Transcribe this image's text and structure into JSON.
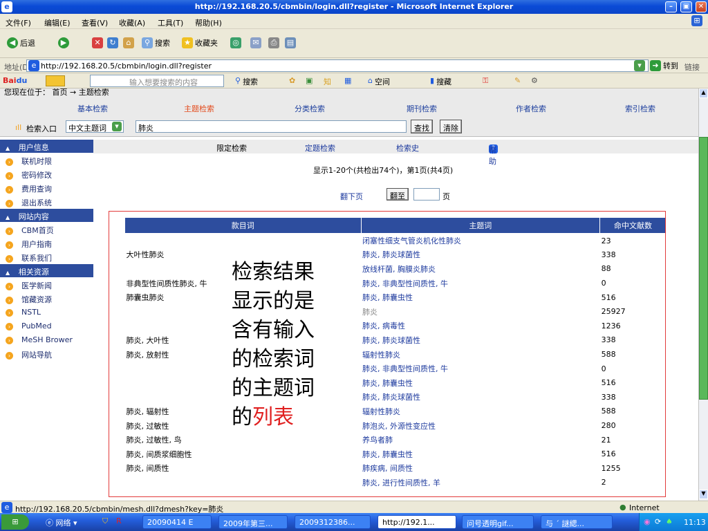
{
  "window": {
    "title": "http://192.168.20.5/cbmbin/login.dll?register - Microsoft Internet Explorer"
  },
  "menu": [
    "文件(F)",
    "编辑(E)",
    "查看(V)",
    "收藏(A)",
    "工具(T)",
    "帮助(H)"
  ],
  "toolbar": {
    "back": "后退",
    "search": "搜索",
    "favorites": "收藏夹"
  },
  "address": {
    "label": "地址(D)",
    "url": "http://192.168.20.5/cbmbin/login.dll?register",
    "go": "转到",
    "links": "链接"
  },
  "baidu": {
    "placeholder": "输入想要搜索的内容",
    "search": "搜索",
    "space": "空间",
    "bookmark": "搜藏"
  },
  "breadcrumb": "您现在位于： 首页 → 主题检索",
  "tabs": [
    "基本检索",
    "主题检索",
    "分类检索",
    "期刊检索",
    "作者检索",
    "索引检索"
  ],
  "search": {
    "entry_label": "检索入口",
    "field": "中文主题词",
    "query": "肺炎",
    "find": "查找",
    "clear": "清除"
  },
  "subnav": [
    "限定检索",
    "定题检索",
    "检索史",
    "帮助"
  ],
  "sidebar": {
    "sections": [
      {
        "title": "用户信息",
        "items": [
          "联机时限",
          "密码修改",
          "费用查询",
          "退出系统"
        ]
      },
      {
        "title": "网站内容",
        "items": [
          "CBM首页",
          "用户指南",
          "联系我们"
        ]
      },
      {
        "title": "相关资源",
        "items": [
          "医学新闻",
          "馆藏资源",
          "NSTL",
          "PubMed",
          "MeSH Brower",
          "网站导航"
        ]
      }
    ]
  },
  "results": {
    "summary": "显示1-20个(共检出74个)，第1页(共4页)",
    "next_page": "翻下页",
    "jump": "翻至",
    "page_unit": "页",
    "headers": [
      "款目词",
      "主题词",
      "命中文献数"
    ],
    "rows": [
      [
        "",
        "闭塞性细支气管炎机化性肺炎",
        "23"
      ],
      [
        "大叶性肺炎",
        "肺炎, 肺炎球菌性",
        "338"
      ],
      [
        "",
        "放线杆菌, 胸膜炎肺炎",
        "88"
      ],
      [
        "非典型性间质性肺炎, 牛",
        "肺炎, 非典型性间质性, 牛",
        "0"
      ],
      [
        "肺囊虫肺炎",
        "肺炎, 肺囊虫性",
        "516"
      ],
      [
        "",
        "肺炎",
        "25927"
      ],
      [
        "",
        "肺炎, 病毒性",
        "1236"
      ],
      [
        "肺炎, 大叶性",
        "肺炎, 肺炎球菌性",
        "338"
      ],
      [
        "肺炎, 放射性",
        "辐射性肺炎",
        "588"
      ],
      [
        "",
        "肺炎, 非典型性间质性, 牛",
        "0"
      ],
      [
        "",
        "肺炎, 肺囊虫性",
        "516"
      ],
      [
        "",
        "肺炎, 肺炎球菌性",
        "338"
      ],
      [
        "肺炎, 辐射性",
        "辐射性肺炎",
        "588"
      ],
      [
        "肺炎, 过敏性",
        "肺泡炎, 外源性变应性",
        "280"
      ],
      [
        "肺炎, 过敏性, 鸟",
        "养鸟者肺",
        "21"
      ],
      [
        "肺炎, 间质浆细胞性",
        "肺炎, 肺囊虫性",
        "516"
      ],
      [
        "肺炎, 间质性",
        "肺疾病, 间质性",
        "1255"
      ],
      [
        "",
        "肺炎, 进行性间质性, 羊",
        "2"
      ]
    ]
  },
  "annotation": {
    "lines": [
      "检索结果",
      "显示的是",
      "含有输入",
      "的检索词",
      "的主题词"
    ],
    "last_prefix": "的",
    "last_highlight": "列表",
    "highlight_color": "#e02020"
  },
  "status": {
    "url": "http://192.168.20.5/cbmbin/mesh.dll?dmesh?key=肺炎",
    "zone": "Internet"
  },
  "taskbar": {
    "items": [
      "网络",
      "20090414 E",
      "2009年第三...",
      "2009312386...",
      "http://192.1...",
      "问号透明gif...",
      "与 ˊ 謎緦..."
    ],
    "clock": "11:13"
  }
}
